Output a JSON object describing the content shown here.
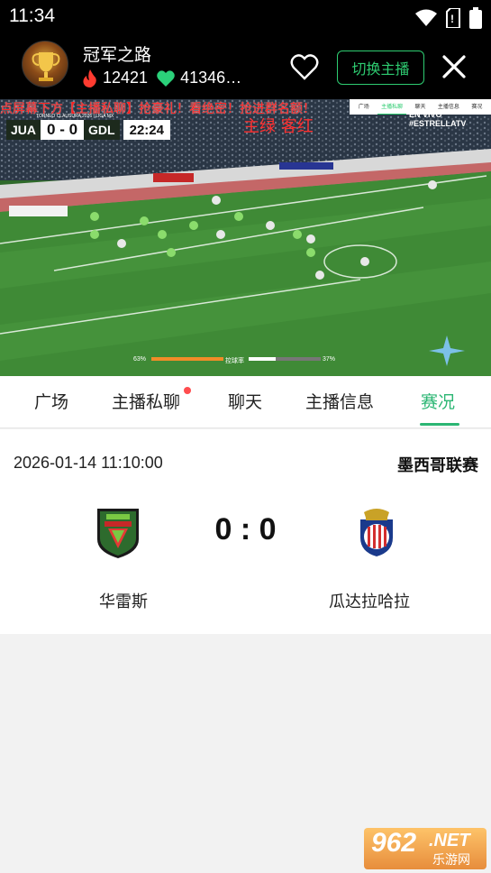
{
  "status_bar": {
    "time": "11:34"
  },
  "header": {
    "streamer_name": "冠军之路",
    "popularity": "12421",
    "likes": "41346…",
    "switch_label": "切换主播"
  },
  "video": {
    "banner": "点屏幕下方【主播私聊】抢豪礼！看绝密！抢进群名额！",
    "caption": "主绿 客红",
    "mini_tabs": [
      "广场",
      "主播私聊",
      "聊天",
      "主播信息",
      "赛况"
    ],
    "league_bug": "TORNEO CLAUSURA 2026 | LIGA MX",
    "home_abbr": "JUA",
    "away_abbr": "GDL",
    "score": "0 - 0",
    "clock": "22:24",
    "channel": "EN VIVO #ESTRELLATV",
    "stats": {
      "home_poss": "63%",
      "label": "控球率",
      "away_poss": "37%"
    }
  },
  "tabs": [
    {
      "label": "广场"
    },
    {
      "label": "主播私聊"
    },
    {
      "label": "聊天"
    },
    {
      "label": "主播信息"
    },
    {
      "label": "赛况"
    }
  ],
  "active_tab": "赛况",
  "match": {
    "datetime": "2026-01-14 11:10:00",
    "league": "墨西哥联赛",
    "score": "0 : 0",
    "home_team": "华雷斯",
    "away_team": "瓜达拉哈拉"
  },
  "watermark": {
    "num": "962",
    "net": ".NET",
    "site": "乐游网"
  },
  "colors": {
    "accent": "#2bb673",
    "dot": "#ff4d4f",
    "header_bg": "#000000"
  }
}
